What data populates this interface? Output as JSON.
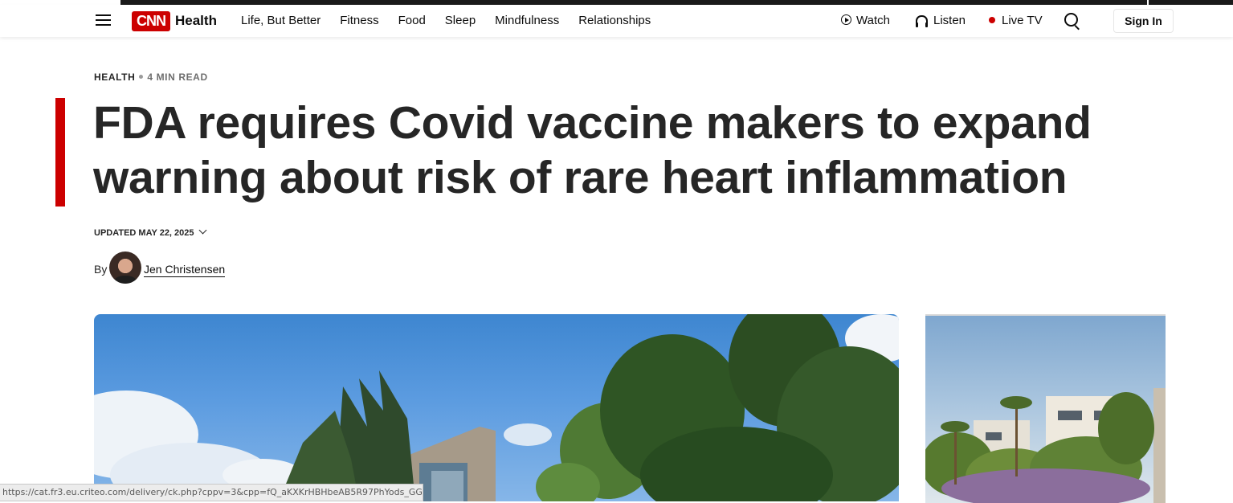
{
  "nav": {
    "logo_text": "CNN",
    "section": "Health",
    "links": [
      "Life, But Better",
      "Fitness",
      "Food",
      "Sleep",
      "Mindfulness",
      "Relationships"
    ],
    "watch": "Watch",
    "listen": "Listen",
    "live_tv": "Live TV",
    "sign_in": "Sign In",
    "brand_color": "#cc0000"
  },
  "article": {
    "section": "HEALTH",
    "read_time": "4 MIN READ",
    "headline": "FDA requires Covid vaccine makers to expand warning about risk of rare heart inflammation",
    "updated": "UPDATED MAY 22, 2025",
    "by_label": "By",
    "author": "Jen Christensen"
  },
  "status_bar": {
    "url": "https://cat.fr3.eu.criteo.com/delivery/ck.php?cppv=3&cpp=fQ_aKXKrHBHbeAB5R97PhYods_GG..."
  }
}
